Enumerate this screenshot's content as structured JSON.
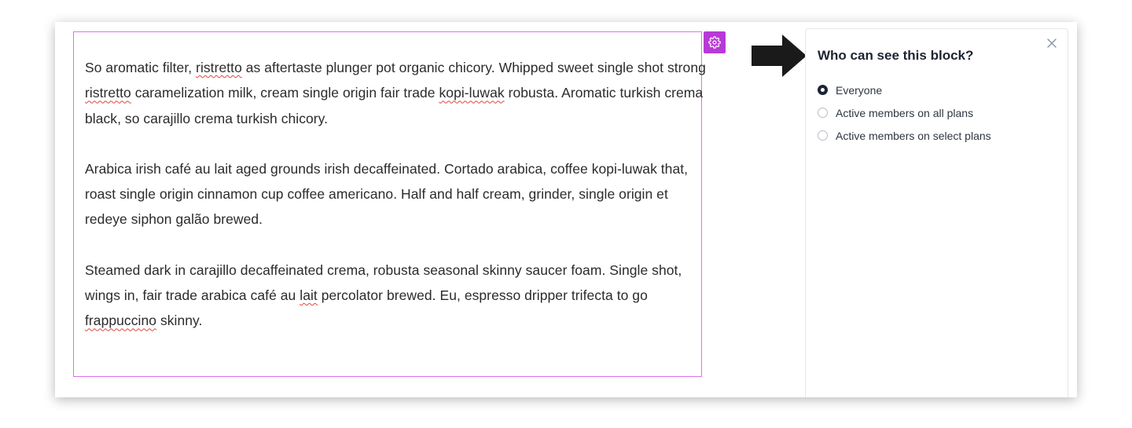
{
  "editor": {
    "paragraphs": [
      [
        {
          "t": "So aromatic filter, "
        },
        {
          "t": "ristretto",
          "sp": true
        },
        {
          "t": " as aftertaste plunger pot organic chicory. Whipped sweet single shot strong "
        },
        {
          "t": "ristretto",
          "sp": true
        },
        {
          "t": " caramelization milk, cream single origin fair trade "
        },
        {
          "t": "kopi-luwak",
          "sp": true
        },
        {
          "t": " robusta. Aromatic turkish crema black, so carajillo crema turkish chicory."
        }
      ],
      [
        {
          "t": "Arabica irish café au lait aged grounds irish decaffeinated. Cortado arabica, coffee kopi-luwak that, roast single origin cinnamon cup coffee americano. Half and half cream, grinder, single origin et redeye siphon galão brewed."
        }
      ],
      [
        {
          "t": "Steamed dark in carajillo decaffeinated crema, robusta seasonal skinny saucer foam. Single shot, wings in, fair trade arabica café au "
        },
        {
          "t": "lait",
          "sp": true
        },
        {
          "t": " percolator brewed. Eu, espresso dripper trifecta to go "
        },
        {
          "t": "frappuccino",
          "sp": true
        },
        {
          "t": " skinny."
        }
      ]
    ],
    "settings_icon": "gear-icon",
    "accent_color": "#b83ad6",
    "border_color": "#e26cf4"
  },
  "visibility_panel": {
    "title": "Who can see this block?",
    "close_icon": "close-icon",
    "options": [
      {
        "label": "Everyone",
        "checked": true
      },
      {
        "label": "Active members on all plans",
        "checked": false
      },
      {
        "label": "Active members on select plans",
        "checked": false
      }
    ]
  },
  "annotation": {
    "icon": "arrow-right-icon",
    "color": "#1a1a1a"
  }
}
